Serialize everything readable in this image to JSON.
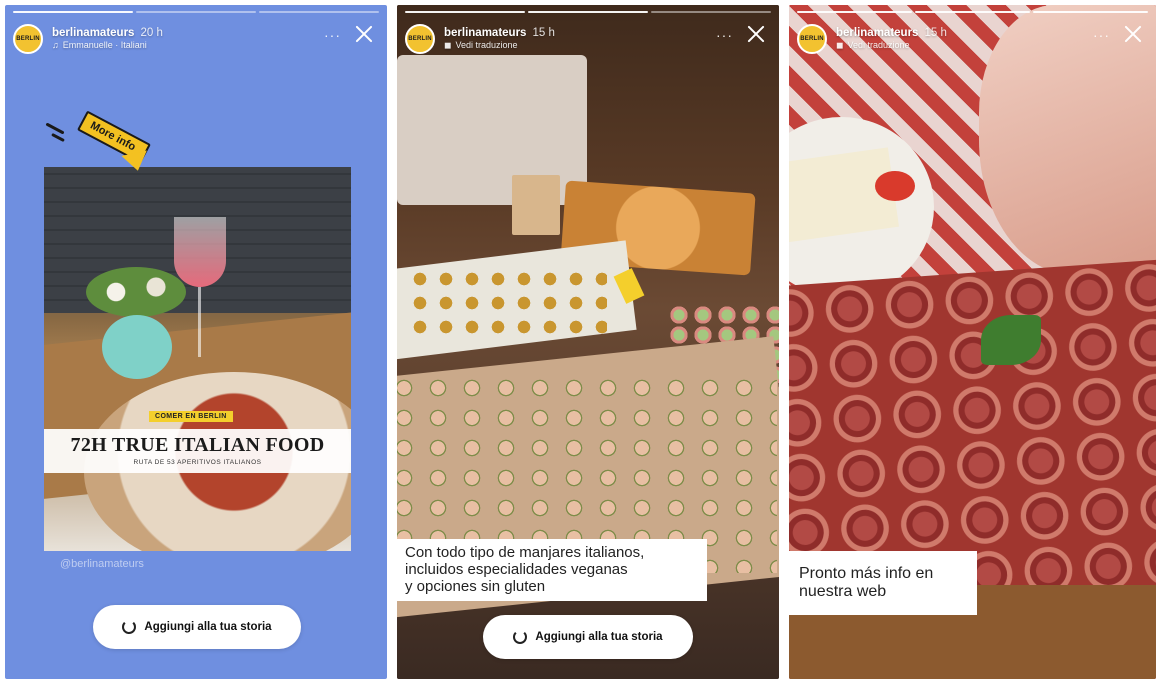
{
  "stories": [
    {
      "username": "berlinamateurs",
      "time": "20 h",
      "subline": "Emmanuelle · Italiani",
      "avatar_text": "BERLIN",
      "sticker": "More info",
      "post_tag": "COMER EN BERLIN",
      "post_title": "72H TRUE ITALIAN FOOD",
      "post_subtitle": "RUTA DE 53 APERITIVOS ITALIANOS",
      "mention": "@berlinamateurs",
      "button": "Aggiungi alla tua storia"
    },
    {
      "username": "berlinamateurs",
      "time": "15 h",
      "subline": "Vedi traduzione",
      "avatar_text": "BERLIN",
      "caption_lines": [
        "Con todo tipo de manjares italianos,",
        "incluidos especialidades veganas",
        "y opciones sin gluten"
      ],
      "button": "Aggiungi alla tua storia"
    },
    {
      "username": "berlinamateurs",
      "time": "15 h",
      "subline": "Vedi traduzione",
      "avatar_text": "BERLIN",
      "caption_lines": [
        "Pronto más info en",
        "nuestra web"
      ]
    }
  ],
  "ui": {
    "more_label": "···",
    "close_label": "close"
  },
  "colors": {
    "story1_bg": "#6f8fe0",
    "sticker": "#f3c121",
    "avatar": "#f2c230"
  }
}
